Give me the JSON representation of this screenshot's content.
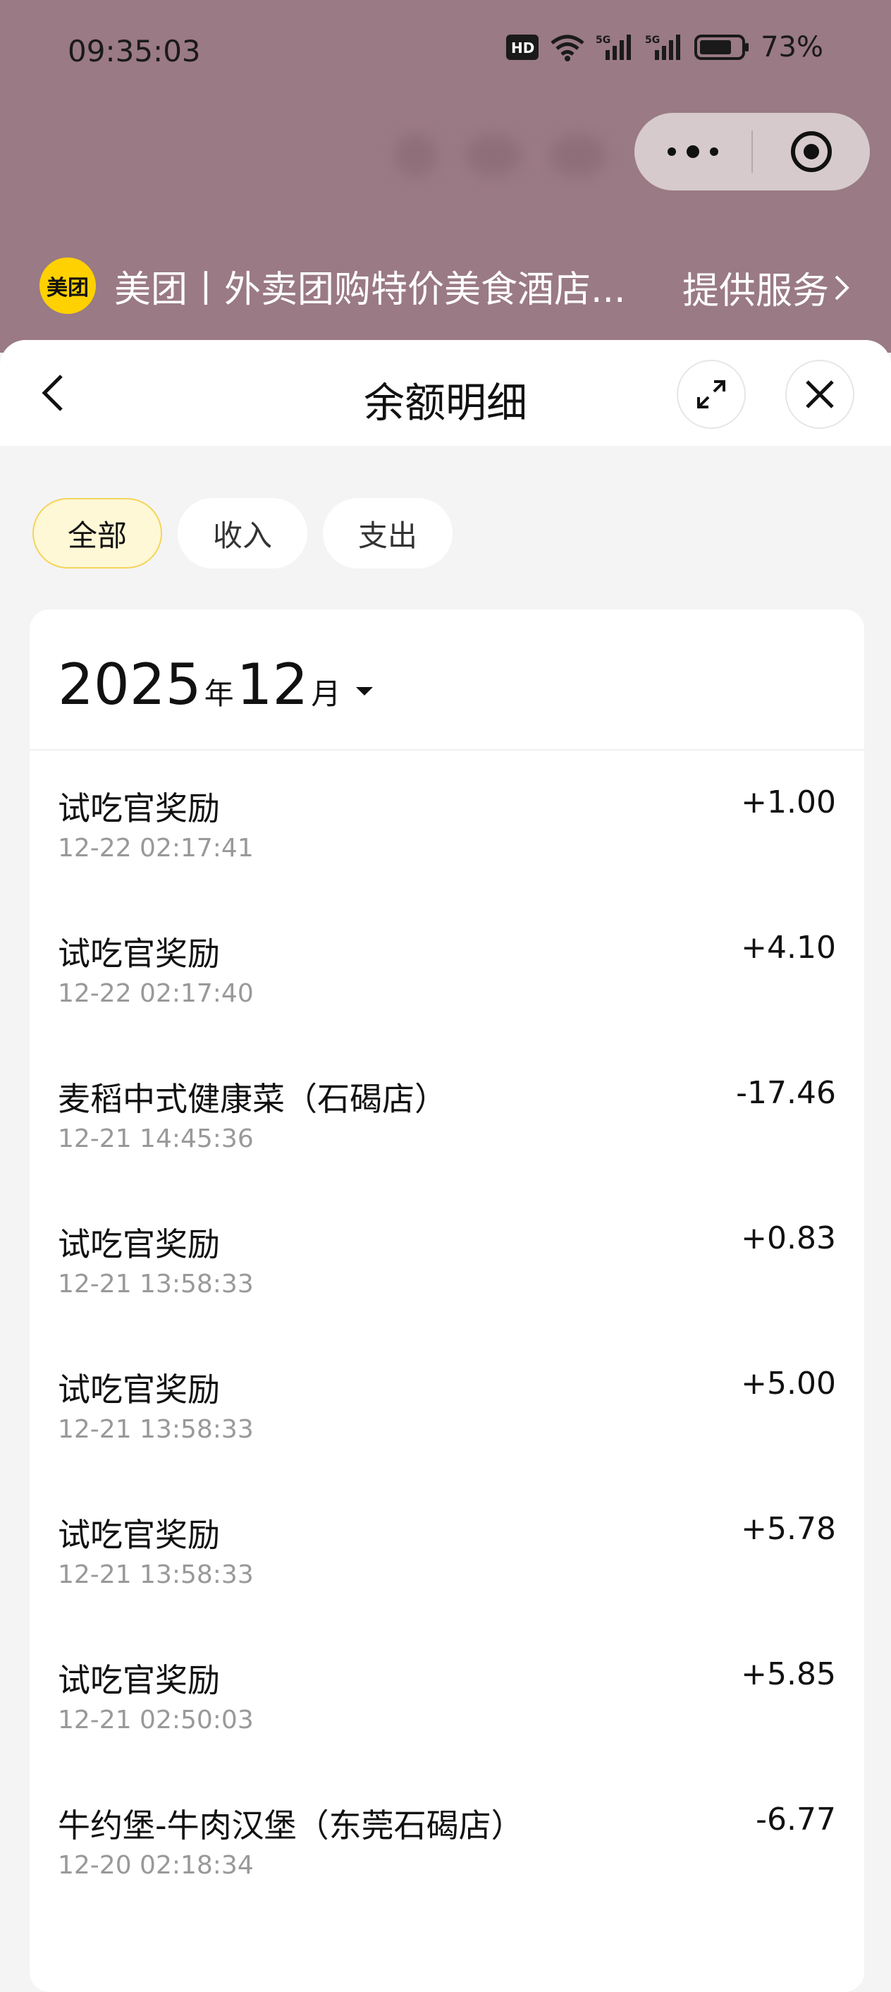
{
  "status_bar": {
    "time": "09:35:03",
    "battery_percent": "73%",
    "icons": [
      "hd-icon",
      "wifi-icon",
      "5g-signal-icon",
      "5g-signal-icon",
      "battery-icon"
    ]
  },
  "mini_program": {
    "logo_text": "美团",
    "name": "美团丨外卖团购特价美食酒店...",
    "service_label": "提供服务",
    "brand_color": "#ffd100"
  },
  "sheet": {
    "title": "余额明细"
  },
  "filters": [
    {
      "label": "全部",
      "active": true
    },
    {
      "label": "收入",
      "active": false
    },
    {
      "label": "支出",
      "active": false
    }
  ],
  "month_selector": {
    "year": "2025",
    "year_unit": "年",
    "month": "12",
    "month_unit": "月"
  },
  "transactions": [
    {
      "title": "试吃官奖励",
      "time": "12-22 02:17:41",
      "amount": "+1.00"
    },
    {
      "title": "试吃官奖励",
      "time": "12-22 02:17:40",
      "amount": "+4.10"
    },
    {
      "title": "麦稻中式健康菜（石碣店）",
      "time": "12-21 14:45:36",
      "amount": "-17.46"
    },
    {
      "title": "试吃官奖励",
      "time": "12-21 13:58:33",
      "amount": "+0.83"
    },
    {
      "title": "试吃官奖励",
      "time": "12-21 13:58:33",
      "amount": "+5.00"
    },
    {
      "title": "试吃官奖励",
      "time": "12-21 13:58:33",
      "amount": "+5.78"
    },
    {
      "title": "试吃官奖励",
      "time": "12-21 02:50:03",
      "amount": "+5.85"
    },
    {
      "title": "牛约堡-牛肉汉堡（东莞石碣店）",
      "time": "12-20 02:18:34",
      "amount": "-6.77"
    }
  ]
}
